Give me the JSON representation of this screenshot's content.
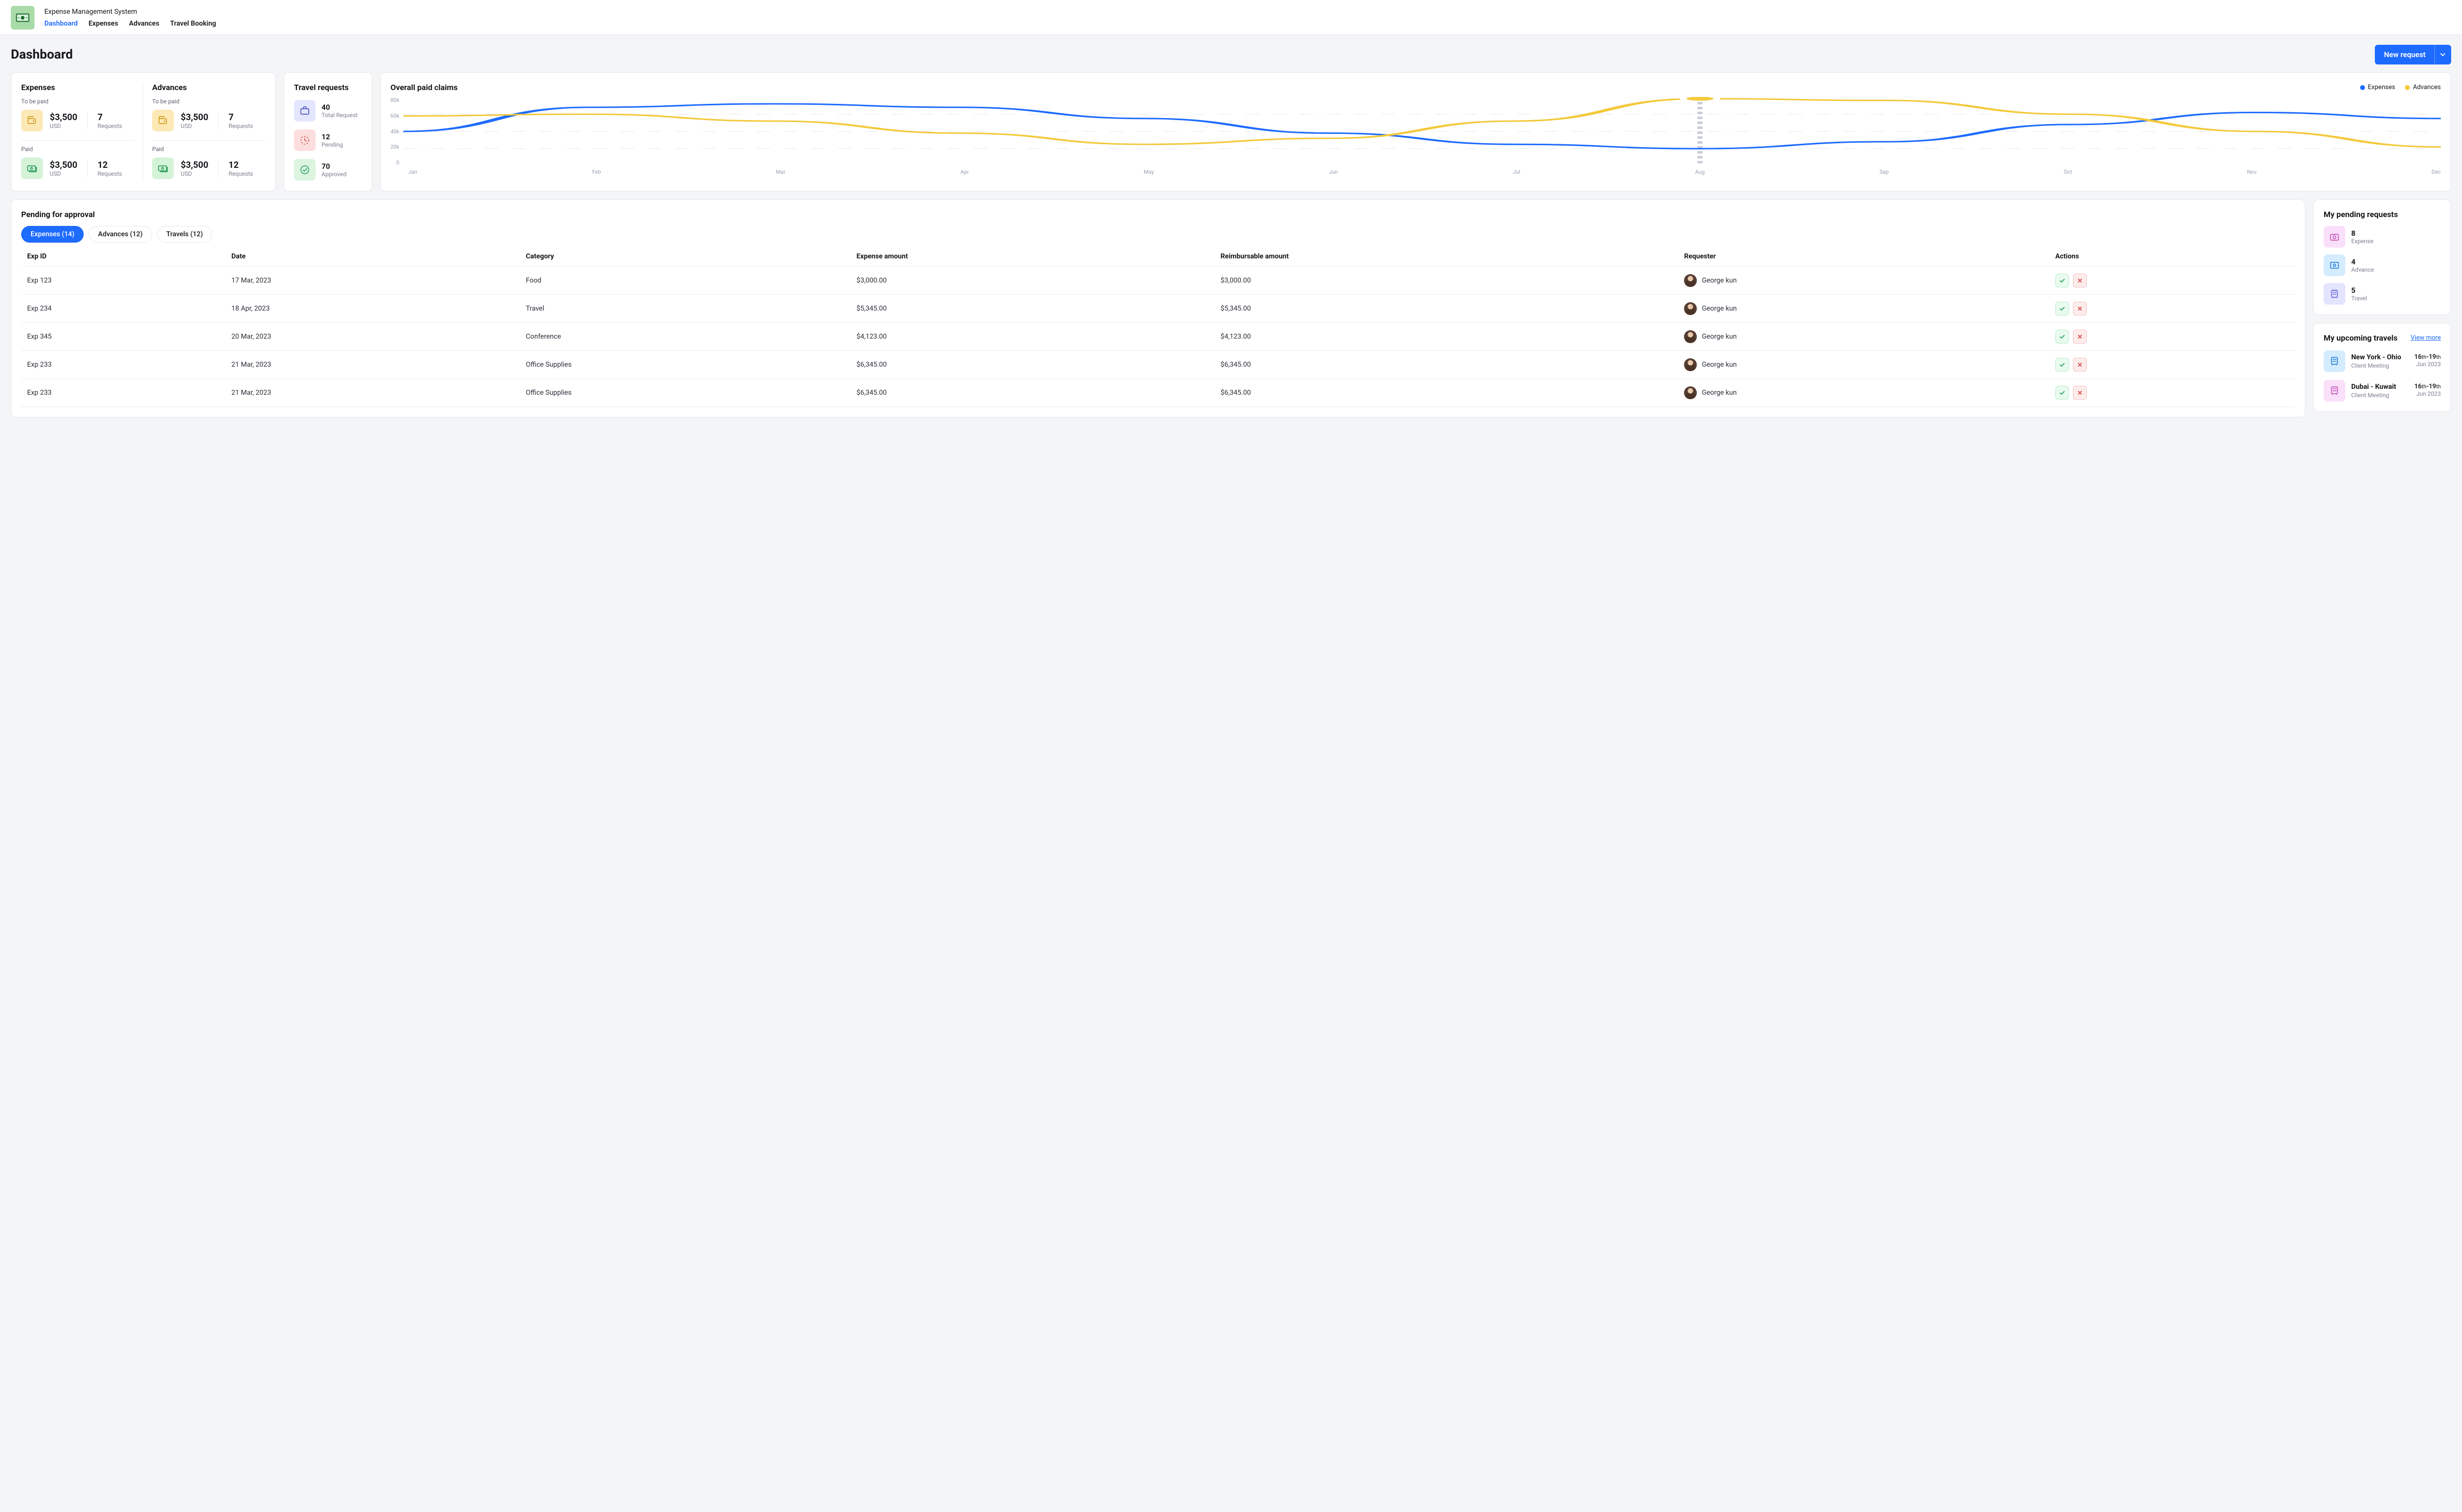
{
  "app": {
    "title": "Expense Management System"
  },
  "nav": {
    "tabs": [
      "Dashboard",
      "Expenses",
      "Advances",
      "Travel Booking"
    ],
    "active": 0
  },
  "page": {
    "title": "Dashboard",
    "new_request": "New request"
  },
  "summary": {
    "expenses": {
      "title": "Expenses",
      "to_be_paid_label": "To be paid",
      "paid_label": "Paid",
      "to_be_paid": {
        "amount": "$3,500",
        "currency": "USD",
        "requests_count": "7",
        "requests_label": "Requests"
      },
      "paid": {
        "amount": "$3,500",
        "currency": "USD",
        "requests_count": "12",
        "requests_label": "Requests"
      }
    },
    "advances": {
      "title": "Advances",
      "to_be_paid_label": "To be paid",
      "paid_label": "Paid",
      "to_be_paid": {
        "amount": "$3,500",
        "currency": "USD",
        "requests_count": "7",
        "requests_label": "Requests"
      },
      "paid": {
        "amount": "$3,500",
        "currency": "USD",
        "requests_count": "12",
        "requests_label": "Requests"
      }
    }
  },
  "travel": {
    "title": "Travel requests",
    "total": {
      "value": "40",
      "label": "Total Request"
    },
    "pending": {
      "value": "12",
      "label": "Pending"
    },
    "approved": {
      "value": "70",
      "label": "Approved"
    }
  },
  "chart": {
    "title": "Overall paid claims",
    "legend": {
      "a": "Expenses",
      "b": "Advances"
    }
  },
  "pending": {
    "title": "Pending for approval",
    "tabs": [
      "Expenses (14)",
      "Advances (12)",
      "Travels (12)"
    ],
    "active": 0,
    "headers": [
      "Exp ID",
      "Date",
      "Category",
      "Expense amount",
      "Reimbursable amount",
      "Requester",
      "Actions"
    ],
    "rows": [
      {
        "id": "Exp 123",
        "date": "17 Mar, 2023",
        "cat": "Food",
        "amt": "$3,000.00",
        "reimb": "$3,000.00",
        "req": "George kun"
      },
      {
        "id": "Exp 234",
        "date": "18 Apr, 2023",
        "cat": "Travel",
        "amt": "$5,345.00",
        "reimb": "$5,345.00",
        "req": "George kun"
      },
      {
        "id": "Exp 345",
        "date": "20 Mar, 2023",
        "cat": "Conference",
        "amt": "$4,123.00",
        "reimb": "$4,123.00",
        "req": "George kun"
      },
      {
        "id": "Exp 233",
        "date": "21 Mar, 2023",
        "cat": "Office Supplies",
        "amt": "$6,345.00",
        "reimb": "$6,345.00",
        "req": "George kun"
      },
      {
        "id": "Exp 233",
        "date": "21 Mar, 2023",
        "cat": "Office Supplies",
        "amt": "$6,345.00",
        "reimb": "$6,345.00",
        "req": "George kun"
      }
    ]
  },
  "myPending": {
    "title": "My pending requests",
    "items": [
      {
        "value": "8",
        "label": "Expense"
      },
      {
        "value": "4",
        "label": "Advance"
      },
      {
        "value": "5",
        "label": "Travel"
      }
    ]
  },
  "travels": {
    "title": "My upcoming travels",
    "view_more": "View more",
    "items": [
      {
        "route": "New York - Ohio",
        "sub": "Client Meeting",
        "dates": "16th-19th",
        "month": "Jun 2023"
      },
      {
        "route": "Dubai - Kuwait",
        "sub": "Client Meeting",
        "dates": "16th-19th",
        "month": "Jun 2023"
      }
    ]
  },
  "chart_data": {
    "type": "line",
    "title": "Overall paid claims",
    "xlabel": "",
    "ylabel": "",
    "ylim": [
      0,
      80000
    ],
    "ytick_labels": [
      "80k",
      "60k",
      "40k",
      "20k",
      "0"
    ],
    "categories": [
      "Jan",
      "Feb",
      "Mar",
      "Apr",
      "May",
      "Jun",
      "Jul",
      "Aug",
      "Sep",
      "Oct",
      "Nov",
      "Dec"
    ],
    "series": [
      {
        "name": "Expenses",
        "color": "#1e6bff",
        "values": [
          40000,
          68000,
          72000,
          68000,
          55000,
          38000,
          25000,
          20000,
          28000,
          48000,
          62000,
          55000
        ]
      },
      {
        "name": "Advances",
        "color": "#f3c93a",
        "values": [
          58000,
          60000,
          52000,
          38000,
          25000,
          32000,
          52000,
          78000,
          76000,
          60000,
          40000,
          22000
        ]
      }
    ],
    "highlight": {
      "category": "Aug",
      "series": "Advances",
      "value": 78000
    }
  }
}
